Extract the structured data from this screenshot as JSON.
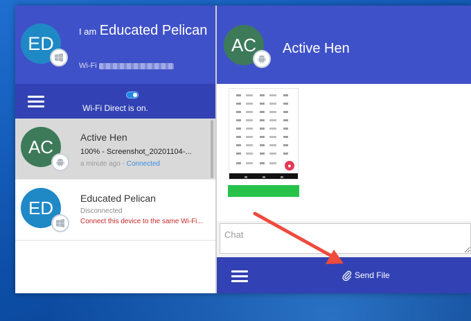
{
  "self": {
    "initials": "ED",
    "name_prefix": "I am",
    "name": "Educated Pelican",
    "wifi_label": "Wi-Fi",
    "os": "windows-icon"
  },
  "toolbar": {
    "menu_icon": "hamburger-menu-icon",
    "wifi_direct_status": "Wi-Fi Direct is on."
  },
  "devices": [
    {
      "initials": "AC",
      "os": "android-icon",
      "color": "#3d7a5a",
      "name": "Active Hen",
      "line1": "100% - Screenshot_20201104-...",
      "time": "a minute ago",
      "separator": " - ",
      "status": "Connected",
      "selected": true
    },
    {
      "initials": "ED",
      "os": "windows-icon",
      "color": "#1f89c6",
      "name": "Educated Pelican",
      "status": "Disconnected",
      "warning": "Connect this device to the same Wi-Fi..."
    }
  ],
  "chat": {
    "peer_initials": "AC",
    "peer_name": "Active Hen",
    "peer_os": "android-icon",
    "transfer_progress": 1.0,
    "input_placeholder": "Chat",
    "send_file_label": "Send File",
    "attach_icon": "paperclip-icon"
  },
  "colors": {
    "header": "#3f51c8",
    "toolbar": "#3242b4",
    "progress": "#27c24a",
    "connected": "#3b8be0",
    "warning": "#c62828",
    "arrow": "#ee4b3d"
  }
}
